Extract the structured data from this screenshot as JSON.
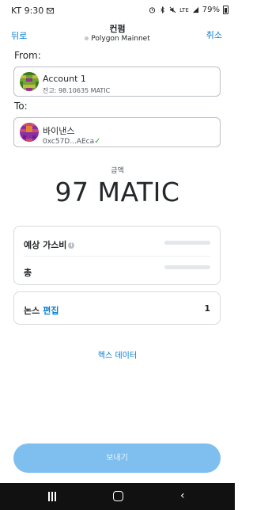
{
  "status_bar": {
    "carrier_time": "KT 9:30",
    "battery_percent": "79%",
    "network_label": "LTE"
  },
  "header": {
    "back_label": "뒤로",
    "title": "컨펌",
    "network": "Polygon Mainnet",
    "cancel_label": "취소"
  },
  "from": {
    "label": "From:",
    "account_name": "Account 1",
    "balance": "잔고: 98.10635 MATIC"
  },
  "to": {
    "label": "To:",
    "account_name": "바이낸스",
    "address": "0xc57D...AEca",
    "verified_icon": "check-icon"
  },
  "amount": {
    "label": "금액",
    "value": "97 MATIC"
  },
  "gas": {
    "estimated_label": "예상 가스비",
    "total_label": "총"
  },
  "nonce": {
    "label": "논스",
    "edit_label": "편집",
    "value": "1"
  },
  "hex_data_link": "헥스 데이터",
  "send_button": "보내기",
  "colors": {
    "accent": "#037dd6",
    "send_disabled": "#7fbfef",
    "verified": "#28a745"
  }
}
